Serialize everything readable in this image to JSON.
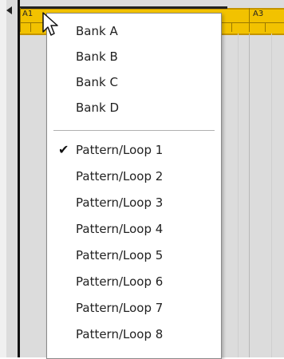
{
  "ruler": {
    "labels": [
      "A1",
      "A3"
    ]
  },
  "menu": {
    "banks": [
      "Bank A",
      "Bank B",
      "Bank C",
      "Bank D"
    ],
    "patterns": [
      "Pattern/Loop 1",
      "Pattern/Loop 2",
      "Pattern/Loop 3",
      "Pattern/Loop 4",
      "Pattern/Loop 5",
      "Pattern/Loop 6",
      "Pattern/Loop 7",
      "Pattern/Loop 8"
    ],
    "checked_item": "Pattern/Loop 1"
  },
  "colors": {
    "ruler": "#f2c200",
    "menu_bg": "#ffffff",
    "background": "#dcdcdc"
  }
}
